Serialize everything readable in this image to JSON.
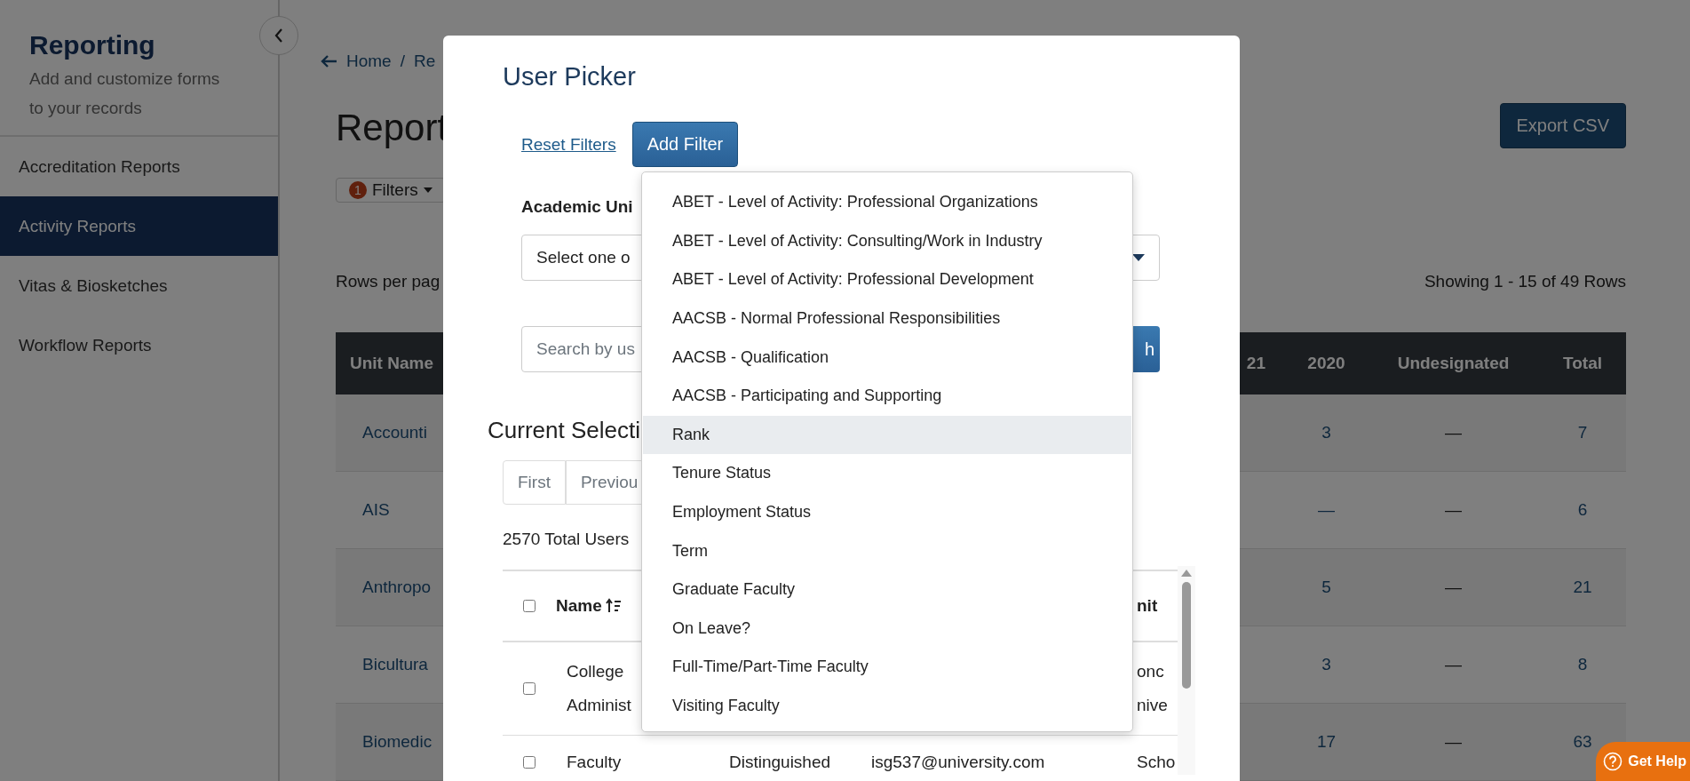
{
  "sidebar": {
    "title": "Reporting",
    "subtitle": "Add and customize forms to your records",
    "items": [
      {
        "label": "Accreditation Reports",
        "selected": false
      },
      {
        "label": "Activity Reports",
        "selected": true
      },
      {
        "label": "Vitas & Biosketches",
        "selected": false
      },
      {
        "label": "Workflow Reports",
        "selected": false
      }
    ]
  },
  "breadcrumb": {
    "items": [
      "Home",
      "Re"
    ],
    "separator": "/"
  },
  "page_title": "Report",
  "filters_button": {
    "badge": "1",
    "label": "Filters"
  },
  "export_button": "Export CSV",
  "rows_per_page_label": "Rows per pag",
  "showing": "Showing 1 - 15 of 49 Rows",
  "table": {
    "columns": [
      "Unit Name",
      "21",
      "2020",
      "Undesignated",
      "Total"
    ],
    "rows": [
      {
        "unit": "Accounti",
        "y2020": "3",
        "undesignated": "—",
        "total": "7"
      },
      {
        "unit": "AIS",
        "y2020": "—",
        "undesignated": "—",
        "total": "6"
      },
      {
        "unit": "Anthropo",
        "y2020": "5",
        "undesignated": "—",
        "total": "21"
      },
      {
        "unit": "Bicultura",
        "y2020": "3",
        "undesignated": "—",
        "total": "8"
      },
      {
        "unit": "Biomedic",
        "y2020": "17",
        "undesignated": "—",
        "total": "63"
      }
    ]
  },
  "modal": {
    "title": "User Picker",
    "reset_link": "Reset Filters",
    "add_filter": "Add Filter",
    "academic_unit_label": "Academic Uni",
    "select_placeholder": "Select one o",
    "search_placeholder": "Search by us",
    "search_button": "h",
    "current_selection_title": "Current Selecti",
    "pagination": [
      "First",
      "Previou"
    ],
    "total_users": "2570 Total Users",
    "user_table": {
      "select_all_checked": false,
      "columns": [
        {
          "label": "Name",
          "sorted": true
        },
        {
          "label": "nit",
          "sorted": false
        }
      ],
      "rows": [
        {
          "checked": false,
          "name": "College Administ",
          "unit": "onc nive"
        },
        {
          "checked": false,
          "name": "Faculty",
          "rank": "Distinguished",
          "email": "isg537@university.com",
          "unit": "Scho"
        }
      ]
    },
    "dropdown": [
      {
        "label": "ABET - Level of Activity: Professional Organizations",
        "selected": false
      },
      {
        "label": "ABET - Level of Activity: Consulting/Work in Industry",
        "selected": false
      },
      {
        "label": "ABET - Level of Activity: Professional Development",
        "selected": false
      },
      {
        "label": "AACSB - Normal Professional Responsibilities",
        "selected": false
      },
      {
        "label": "AACSB - Qualification",
        "selected": false
      },
      {
        "label": "AACSB - Participating and Supporting",
        "selected": false
      },
      {
        "label": "Rank",
        "selected": true
      },
      {
        "label": "Tenure Status",
        "selected": false
      },
      {
        "label": "Employment Status",
        "selected": false
      },
      {
        "label": "Term",
        "selected": false
      },
      {
        "label": "Graduate Faculty",
        "selected": false
      },
      {
        "label": "On Leave?",
        "selected": false
      },
      {
        "label": "Full-Time/Part-Time Faculty",
        "selected": false
      },
      {
        "label": "Visiting Faculty",
        "selected": false
      }
    ]
  },
  "get_help": "Get Help"
}
